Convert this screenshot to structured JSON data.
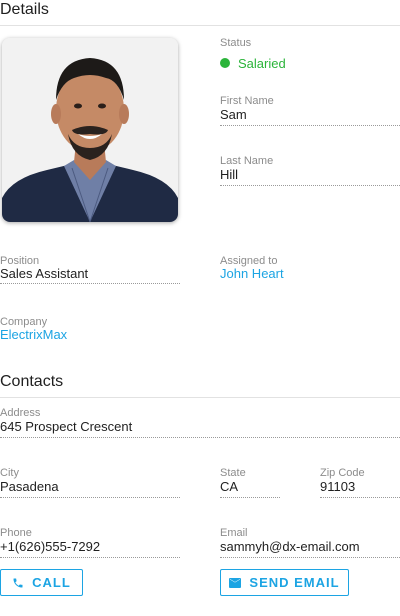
{
  "details": {
    "title": "Details",
    "status_label": "Status",
    "status_value": "Salaried",
    "status_color": "#2bb43a",
    "first_name_label": "First Name",
    "first_name": "Sam",
    "last_name_label": "Last Name",
    "last_name": "Hill",
    "position_label": "Position",
    "position": "Sales Assistant",
    "assigned_label": "Assigned to",
    "assigned_to": "John Heart",
    "company_label": "Company",
    "company": "ElectrixMax",
    "photo_icon": "person-photo"
  },
  "contacts": {
    "title": "Contacts",
    "address_label": "Address",
    "address": "645 Prospect Crescent",
    "city_label": "City",
    "city": "Pasadena",
    "state_label": "State",
    "state": "CA",
    "zip_label": "Zip Code",
    "zip": "91103",
    "phone_label": "Phone",
    "phone": "+1(626)555-7292",
    "email_label": "Email",
    "email": "sammyh@dx-email.com"
  },
  "actions": {
    "call_label": "CALL",
    "call_icon": "phone-icon",
    "email_label": "SEND EMAIL",
    "email_icon": "envelope-icon"
  },
  "colors": {
    "accent": "#1ca4e3",
    "status": "#2bb43a"
  }
}
